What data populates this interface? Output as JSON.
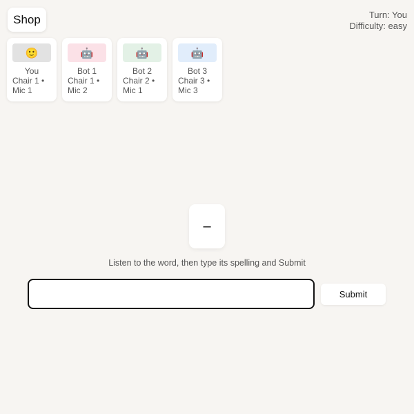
{
  "header": {
    "shop_label": "Shop",
    "turn_text": "Turn: You",
    "difficulty_text": "Difficulty: easy"
  },
  "players": [
    {
      "icon": "smiley-face-icon",
      "glyph": "🙂",
      "avatar_color": "#e2e2e2",
      "name": "You",
      "seat": "Chair 1 • Mic 1"
    },
    {
      "icon": "robot-icon",
      "glyph": "🤖",
      "avatar_color": "#fbe1e7",
      "name": "Bot 1",
      "seat": "Chair 1 • Mic 2"
    },
    {
      "icon": "robot-icon",
      "glyph": "🤖",
      "avatar_color": "#e3f1e6",
      "name": "Bot 2",
      "seat": "Chair 2 • Mic 1"
    },
    {
      "icon": "robot-icon",
      "glyph": "🤖",
      "avatar_color": "#e1edfb",
      "name": "Bot 3",
      "seat": "Chair 3 • Mic 3"
    }
  ],
  "game": {
    "word_display": "–",
    "instruction": "Listen to the word, then type its spelling and Submit",
    "input_value": "",
    "input_placeholder": "",
    "submit_label": "Submit"
  }
}
